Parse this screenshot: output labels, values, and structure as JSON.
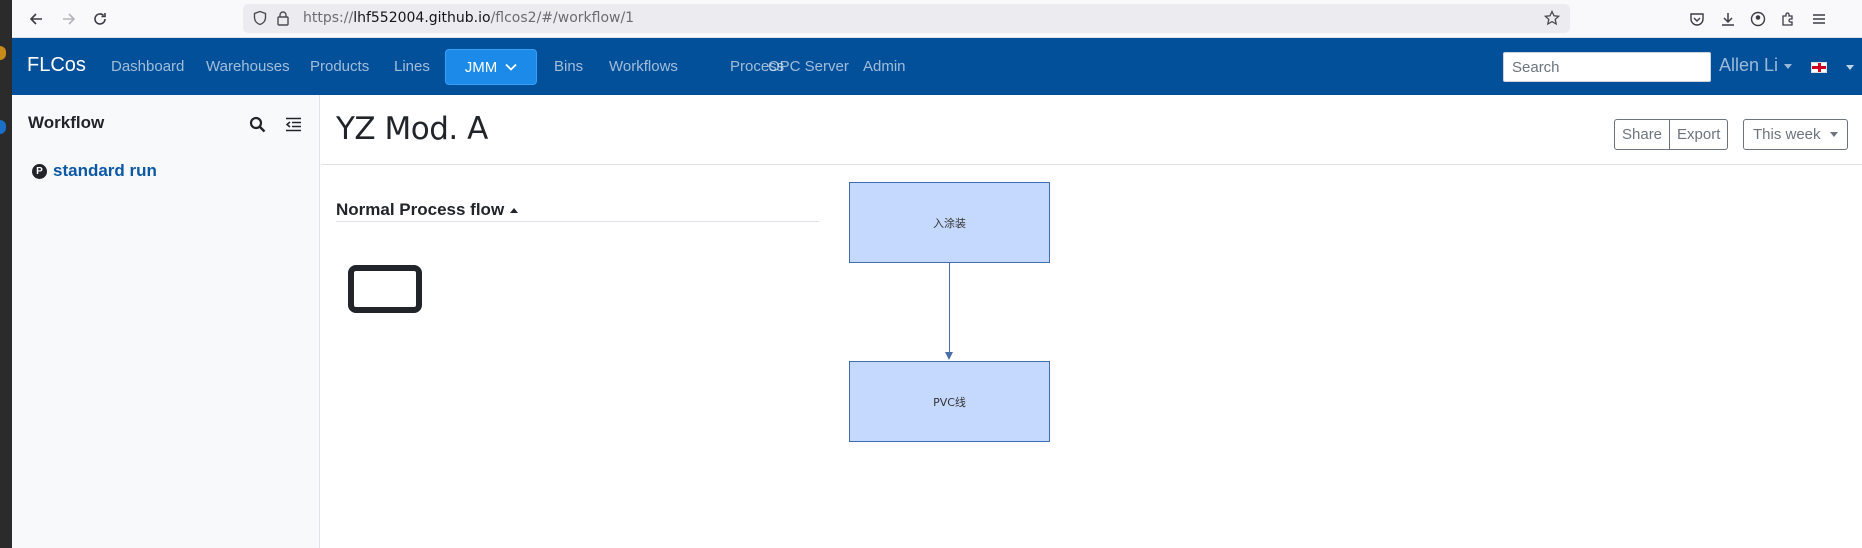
{
  "browser": {
    "url_prefix": "https://",
    "url_host": "lhf552004.github.io",
    "url_path": "/flcos2/#/workflow/1"
  },
  "navbar": {
    "brand": "FLCos",
    "links": [
      "Dashboard",
      "Warehouses",
      "Products",
      "Lines",
      "JMM",
      "Bins",
      "Workflows",
      "Process",
      "OPC Server",
      "Admin"
    ],
    "active_link": "JMM",
    "search_placeholder": "Search",
    "user_name": "Allen Li"
  },
  "sidebar": {
    "title": "Workflow",
    "items": [
      {
        "badge": "P",
        "label": "standard run"
      }
    ]
  },
  "main": {
    "title": "YZ Mod. A",
    "share_label": "Share",
    "export_label": "Export",
    "period_label": "This week",
    "section_title": "Normal Process flow"
  },
  "flow": {
    "nodes": [
      "入涂装",
      "PVC线"
    ]
  },
  "colors": {
    "navbar_bg": "#02509a",
    "active_tab": "#1b8ae8",
    "flow_node_fill": "#c5d8fd",
    "flow_node_stroke": "#3f6cb4",
    "link_color": "#0a58a6"
  }
}
